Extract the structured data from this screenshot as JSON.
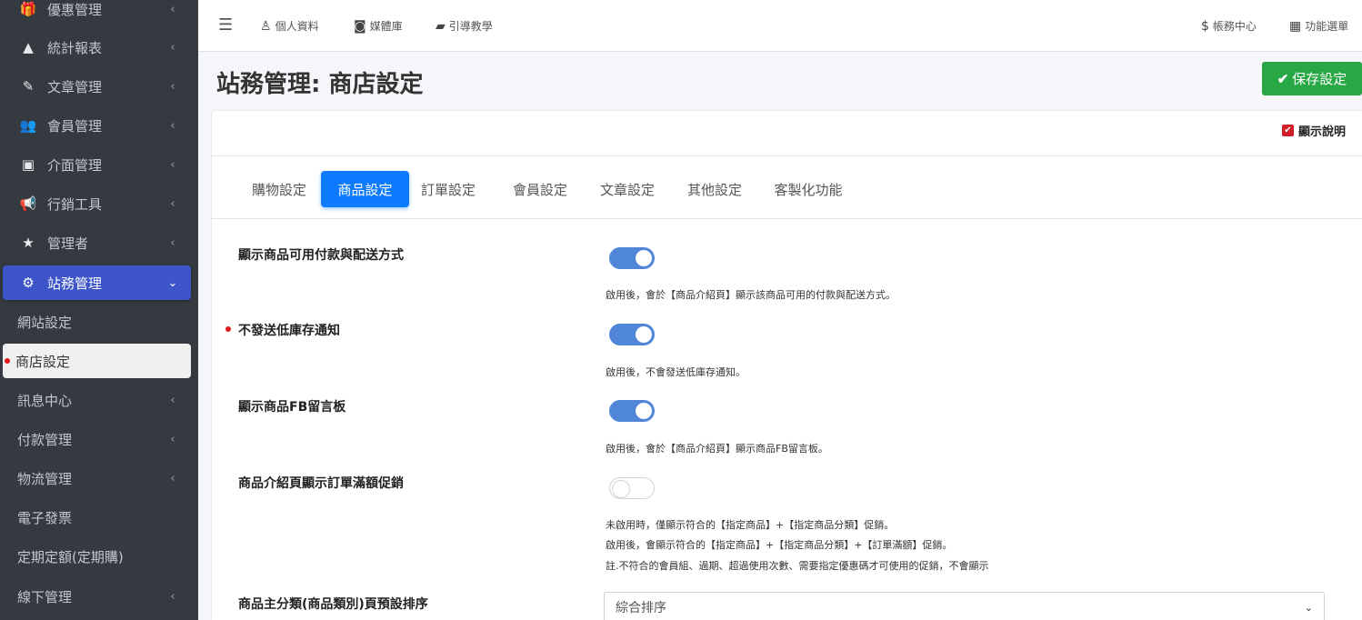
{
  "sidebar": {
    "items": [
      {
        "label": "優惠管理",
        "icon": "gift-icon",
        "glyph": "🎁"
      },
      {
        "label": "統計報表",
        "icon": "area-chart-icon",
        "glyph": "▲"
      },
      {
        "label": "文章管理",
        "icon": "edit-icon",
        "glyph": "✎"
      },
      {
        "label": "會員管理",
        "icon": "users-icon",
        "glyph": "👥"
      },
      {
        "label": "介面管理",
        "icon": "image-icon",
        "glyph": "▣"
      },
      {
        "label": "行銷工具",
        "icon": "bullhorn-icon",
        "glyph": "📢"
      },
      {
        "label": "管理者",
        "icon": "star-icon",
        "glyph": "★"
      },
      {
        "label": "站務管理",
        "icon": "cogs-icon",
        "glyph": "⚙"
      }
    ],
    "sub_items": [
      {
        "label": "網站設定"
      },
      {
        "label": "商店設定"
      }
    ],
    "more_items": [
      {
        "label": "訊息中心",
        "has_chevron": true
      },
      {
        "label": "付款管理",
        "has_chevron": true
      },
      {
        "label": "物流管理",
        "has_chevron": true
      },
      {
        "label": "電子發票",
        "has_chevron": false
      },
      {
        "label": "定期定額(定期購)",
        "has_chevron": false
      },
      {
        "label": "線下管理",
        "has_chevron": true
      }
    ],
    "chevron_left": "‹",
    "chevron_down": "⌄"
  },
  "topbar": {
    "menu_glyph": "☰",
    "links": [
      {
        "label": "個人資料",
        "icon": "user-icon",
        "glyph": "♙"
      },
      {
        "label": "媒體庫",
        "icon": "camera-icon",
        "glyph": "◙"
      },
      {
        "label": "引導教學",
        "icon": "book-icon",
        "glyph": "▰"
      }
    ],
    "right_links": [
      {
        "label": "帳務中心",
        "icon": "dollar-icon",
        "glyph": "$"
      },
      {
        "label": "功能選單",
        "icon": "grid-icon",
        "glyph": "▦"
      }
    ]
  },
  "page": {
    "title": "站務管理: 商店設定",
    "save_label": "保存設定",
    "save_glyph": "✔",
    "show_help_label": "顯示說明",
    "checkbox_glyph": "✔"
  },
  "tabs": [
    {
      "label": "購物設定",
      "active": false
    },
    {
      "label": "商品設定",
      "active": true
    },
    {
      "label": "訂單設定",
      "active": false
    },
    {
      "label": "會員設定",
      "active": false
    },
    {
      "label": "文章設定",
      "active": false
    },
    {
      "label": "其他設定",
      "active": false
    },
    {
      "label": "客製化功能",
      "active": false
    }
  ],
  "settings": [
    {
      "label": "顯示商品可用付款與配送方式",
      "enabled": true,
      "help": [
        "啟用後，會於【商品介紹頁】顯示該商品可用的付款與配送方式。"
      ]
    },
    {
      "label": "不發送低庫存通知",
      "enabled": true,
      "help": [
        "啟用後，不會發送低庫存通知。"
      ]
    },
    {
      "label": "顯示商品FB留言板",
      "enabled": true,
      "help": [
        "啟用後，會於【商品介紹頁】顯示商品FB留言板。"
      ]
    },
    {
      "label": "商品介紹頁顯示訂單滿額促銷",
      "enabled": false,
      "help": [
        "未啟用時，僅顯示符合的【指定商品】+【指定商品分類】促銷。",
        "啟用後，會顯示符合的【指定商品】+【指定商品分類】+【訂單滿額】促銷。",
        "註.不符合的會員組、過期、超過使用次數、需要指定優惠碼才可使用的促銷，不會顯示"
      ]
    }
  ],
  "sort_setting": {
    "label": "商品主分類(商品類別)頁預設排序",
    "selected": "綜合排序",
    "caret": "⌄"
  },
  "colors": {
    "sidebar_bg": "#343a40",
    "active_menu": "#3d55c8",
    "tab_active": "#0d7bff",
    "toggle_on": "#4f86d8",
    "save_button": "#28a745",
    "marker": "#e21c1c"
  }
}
